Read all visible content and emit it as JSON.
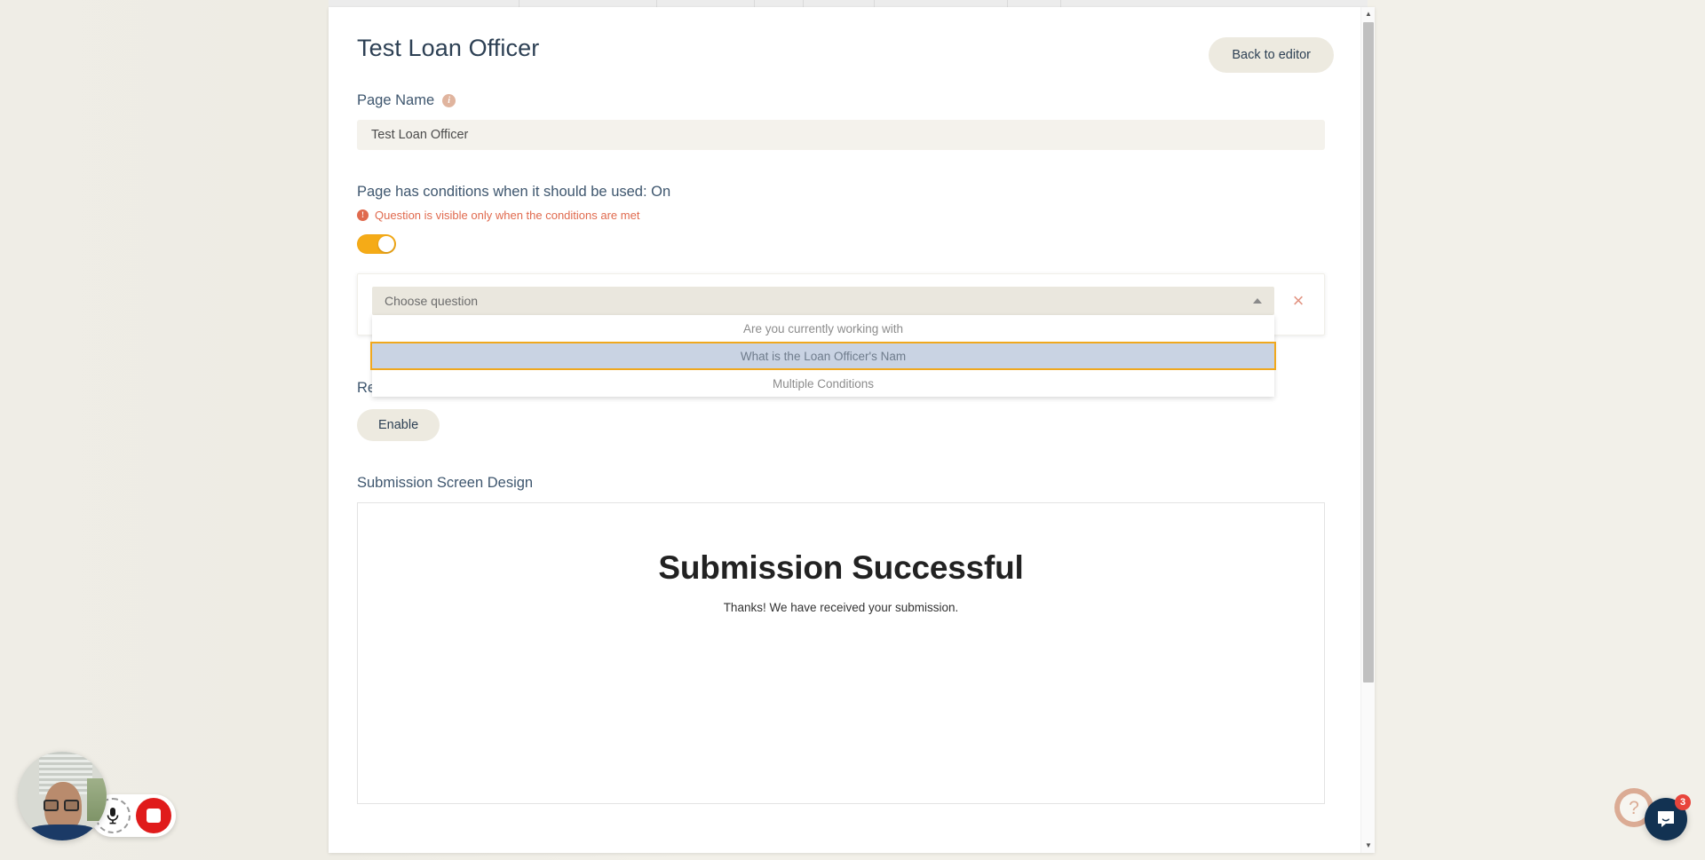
{
  "background": {
    "grid_columns": [
      215,
      155,
      110,
      55,
      80,
      150,
      60
    ]
  },
  "header": {
    "title": "Test Loan Officer",
    "back_button": "Back to editor"
  },
  "page_name": {
    "label": "Page Name",
    "info_icon": "info-icon",
    "info_glyph": "i",
    "value": "Test Loan Officer",
    "placeholder": "Page Name"
  },
  "conditions": {
    "title": "Page has conditions when it should be used: On",
    "note": "Question is visible only when the conditions are met",
    "note_icon": "warning-icon",
    "note_glyph": "!",
    "toggle_state": "on",
    "toggle_color": "#f5ab17"
  },
  "condition_card": {
    "select": {
      "placeholder": "Choose question",
      "caret_icon": "chevron-up-icon",
      "expanded": true,
      "options": [
        {
          "label": "Are you currently working with",
          "active": false
        },
        {
          "label": "What is the Loan Officer's Nam",
          "active": true
        },
        {
          "label": "Multiple Conditions",
          "active": false
        }
      ]
    },
    "close_icon": "close-icon",
    "close_glyph": "×",
    "highlight_color": "#f0a81e"
  },
  "redirect": {
    "title": "Redirect to another URL",
    "enable_label": "Enable"
  },
  "submission": {
    "title": "Submission Screen Design",
    "preview_heading": "Submission Successful",
    "preview_sub": "Thanks! We have received your submission."
  },
  "scrollbar": {
    "up_arrow": "▲",
    "down_arrow": "▼"
  },
  "recorder": {
    "webcam_name": "webcam-preview",
    "mic_icon": "microphone-icon",
    "stop_icon": "stop-recording-icon"
  },
  "widgets": {
    "help_icon": "question-mark-icon",
    "help_glyph": "?",
    "chat_icon": "chat-bubble-icon",
    "chat_badge": "3"
  }
}
